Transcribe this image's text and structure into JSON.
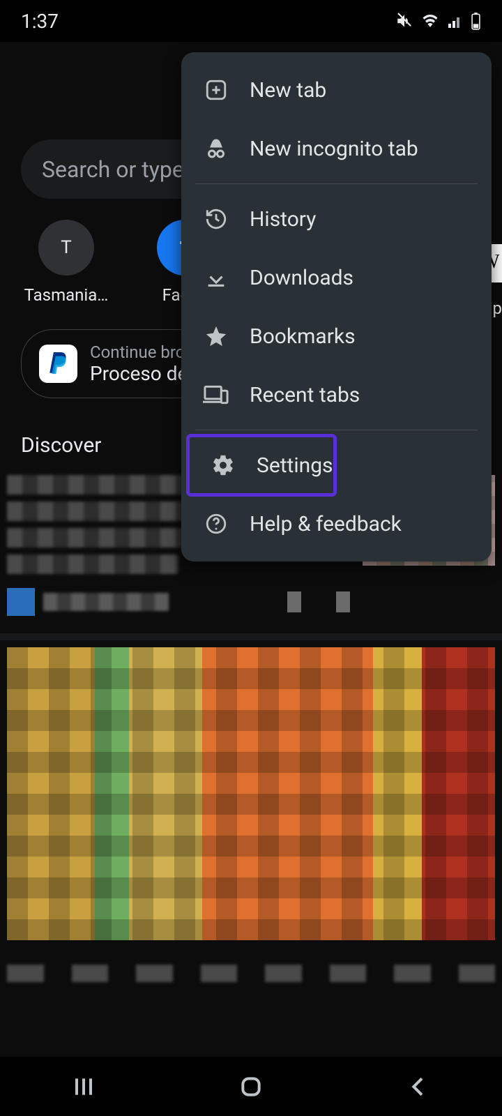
{
  "status": {
    "time": "1:37"
  },
  "search": {
    "placeholder": "Search or type "
  },
  "shortcuts": [
    {
      "letter": "T",
      "label": "Tasmania…"
    },
    {
      "letter": "f",
      "label": "Faceb"
    }
  ],
  "continue": {
    "line1": "Continue brow",
    "line2": "Proceso de "
  },
  "discover": {
    "heading": "Discover"
  },
  "menu": {
    "new_tab": "New tab",
    "new_incognito": "New incognito tab",
    "history": "History",
    "downloads": "Downloads",
    "bookmarks": "Bookmarks",
    "recent_tabs": "Recent tabs",
    "settings": "Settings",
    "help": "Help & feedback",
    "highlighted": "settings"
  },
  "edge": {
    "letter": "W",
    "text": "ip"
  },
  "colors": {
    "highlight": "#5a2fd8"
  }
}
